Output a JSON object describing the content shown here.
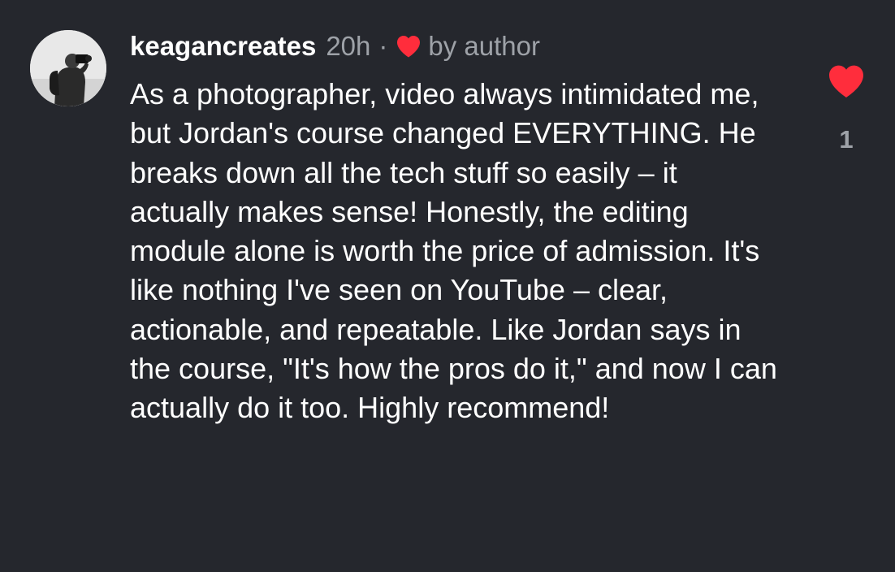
{
  "comment": {
    "username": "keagancreates",
    "timestamp": "20h",
    "separator": "·",
    "author_like_label": "by author",
    "text": "As a photographer, video always intimidated me, but Jordan's course changed EVERYTHING. He breaks down all the tech stuff so easily – it actually makes sense! Honestly, the editing module alone is worth the price of admission. It's like nothing I've seen on YouTube – clear, actionable, and repeatable. Like Jordan says in the course, \"It's how the pros do it,\" and now I can actually do it too. Highly recommend!",
    "like_count": "1",
    "liked": true
  },
  "colors": {
    "background": "#25272d",
    "text": "#ffffff",
    "muted": "#9ea2a8",
    "heart": "#ff2d3c"
  },
  "icons": {
    "avatar": "profile-photo",
    "author_heart": "heart-filled-icon",
    "like_button": "heart-filled-icon"
  }
}
